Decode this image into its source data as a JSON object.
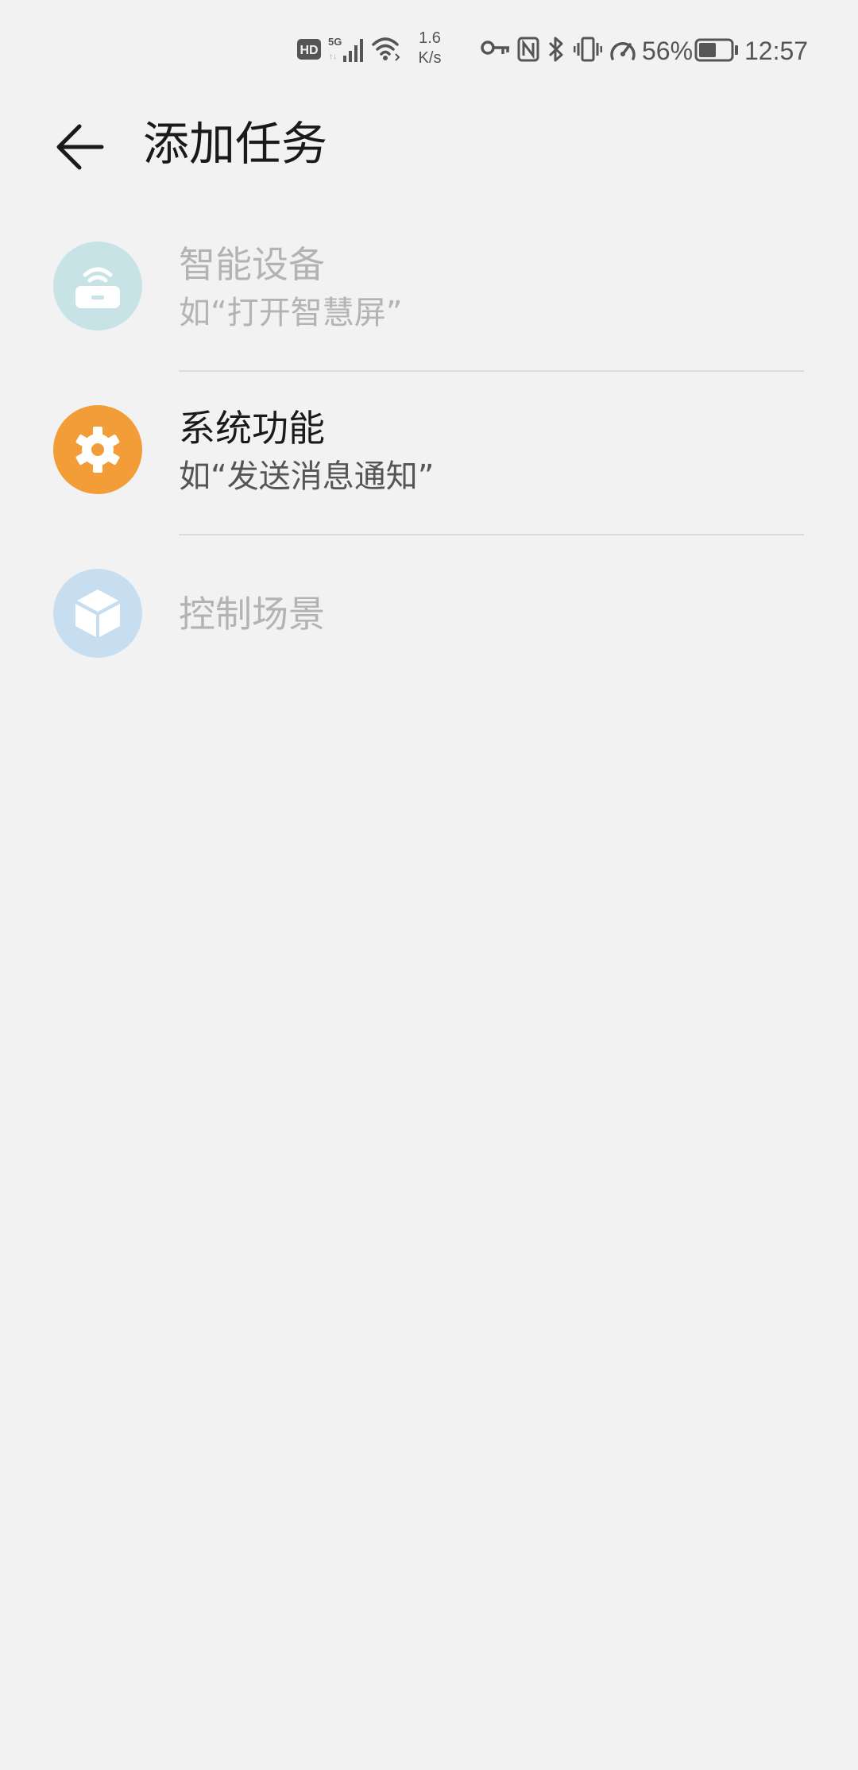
{
  "status_bar": {
    "hd_badge": "HD",
    "network_type": "5G",
    "net_speed_value": "1.6",
    "net_speed_unit": "K/s",
    "battery_percent": "56%",
    "time": "12:57",
    "battery_level": 0.56,
    "icons": [
      "hd-icon",
      "5g-signal-icon",
      "wifi-icon",
      "key-icon",
      "nfc-icon",
      "bluetooth-icon",
      "vibrate-icon",
      "speedometer-icon",
      "battery-icon"
    ]
  },
  "header": {
    "back_icon": "arrow-left-icon",
    "title": "添加任务"
  },
  "tasks": [
    {
      "title": "智能设备",
      "subtitle": "如“打开智慧屏”",
      "icon": "router-icon",
      "icon_color": "#c8e3e6",
      "enabled": false
    },
    {
      "title": "系统功能",
      "subtitle": "如“发送消息通知”",
      "icon": "gear-icon",
      "icon_color": "#f29d37",
      "enabled": true
    },
    {
      "title": "控制场景",
      "icon": "cube-icon",
      "icon_color": "#c6def0",
      "enabled": false
    }
  ],
  "colors": {
    "background": "#f2f2f2",
    "divider": "#dcdcdc",
    "disabled_text": "#b3b3b3",
    "primary_text": "#1a1a1a",
    "secondary_text": "#555555"
  }
}
